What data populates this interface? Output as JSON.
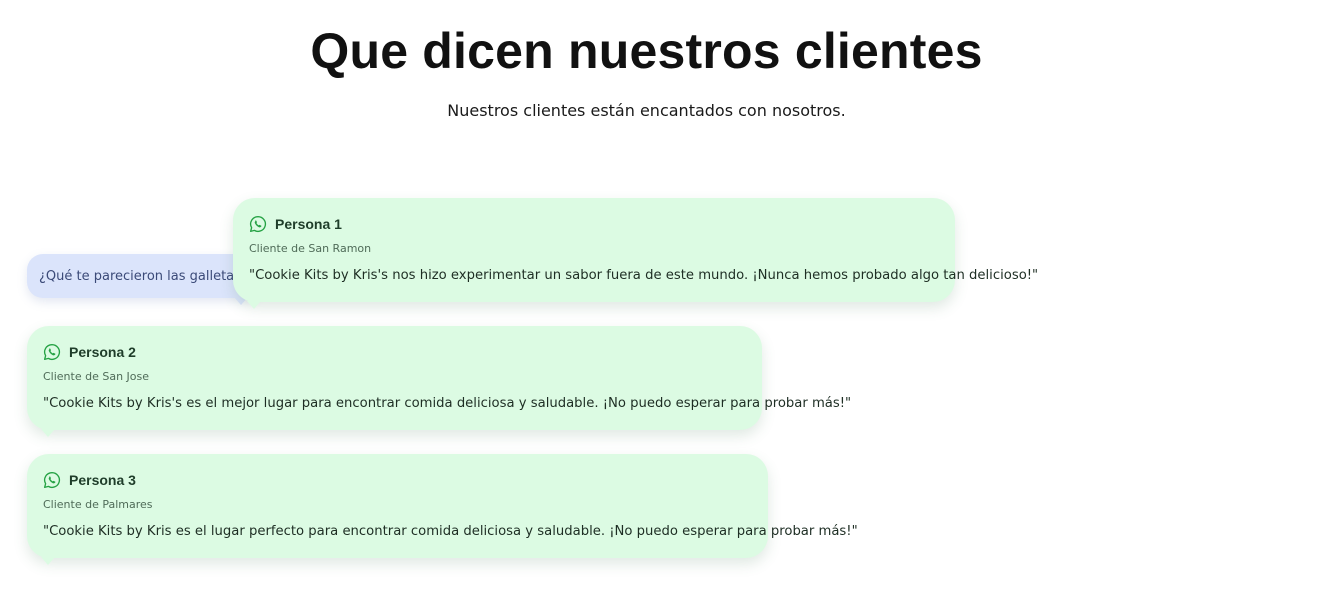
{
  "header": {
    "title": "Que dicen nuestros clientes",
    "subtitle": "Nuestros clientes están encantados con nosotros."
  },
  "question": {
    "text": "¿Qué te parecieron las galletas?"
  },
  "testimonials": [
    {
      "icon": "whatsapp-icon",
      "name": "Persona 1",
      "location": "Cliente de San Ramon",
      "quote": "\"Cookie Kits by Kris's nos hizo experimentar un sabor fuera de este mundo. ¡Nunca hemos probado algo tan delicioso!\""
    },
    {
      "icon": "whatsapp-icon",
      "name": "Persona 2",
      "location": "Cliente de San Jose",
      "quote": "\"Cookie Kits by Kris's es el mejor lugar para encontrar comida deliciosa y saludable. ¡No puedo esperar para probar más!\""
    },
    {
      "icon": "whatsapp-icon",
      "name": "Persona 3",
      "location": "Cliente de Palmares",
      "quote": "\"Cookie Kits by Kris es el lugar perfecto para encontrar comida deliciosa y saludable. ¡No puedo esperar para probar más!\""
    }
  ],
  "colors": {
    "card_background": "#dcfbe3",
    "question_background": "#dbe4fb",
    "whatsapp_green": "#25a244"
  }
}
